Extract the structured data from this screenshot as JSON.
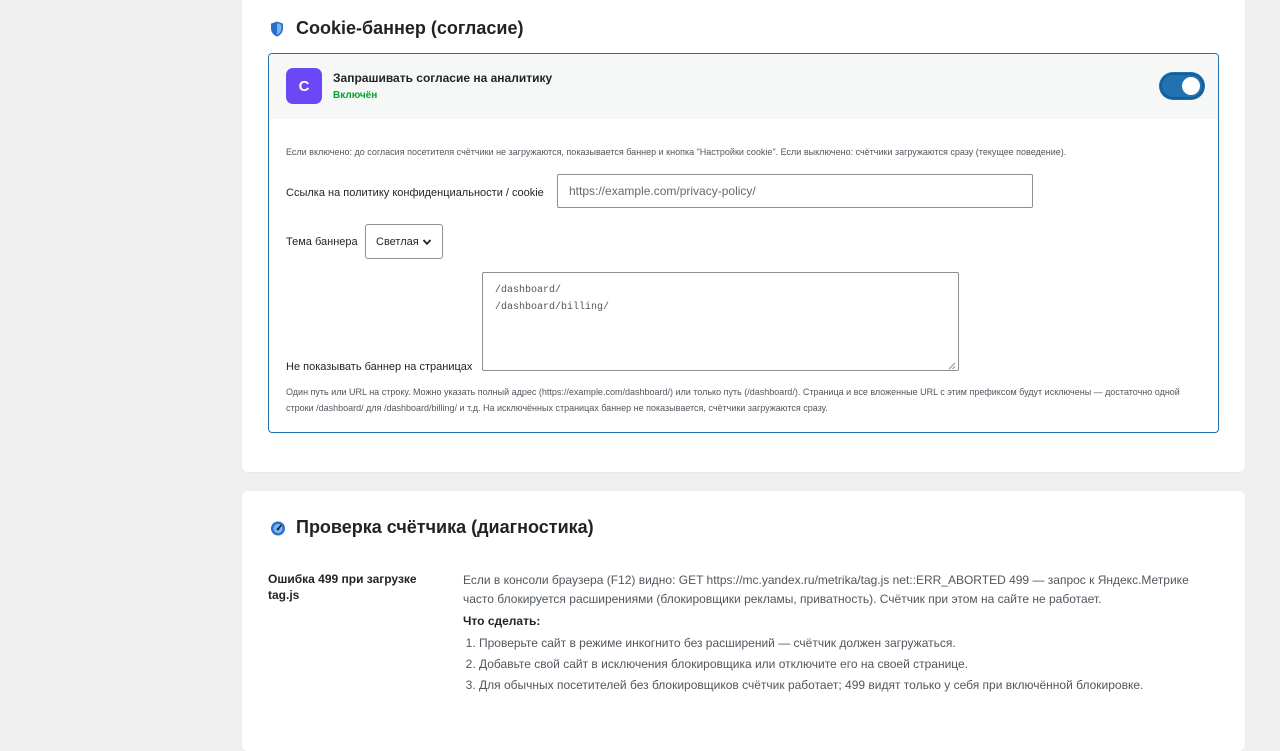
{
  "cookie_section": {
    "title": "Cookie-баннер (согласие)",
    "icon": "shield-icon",
    "feature": {
      "avatar_letter": "C",
      "avatar_color": "#6c47f5",
      "title": "Запрашивать согласие на аналитику",
      "status": "Включён",
      "status_color": "#00a32a",
      "enabled": true,
      "description": "Если включено: до согласия посетителя счётчики не загружаются, показывается баннер и кнопка \"Настройки cookie\". Если выключено: счётчики загружаются сразу (текущее поведение).",
      "privacy_label": "Ссылка на политику конфиденциальности / cookie",
      "privacy_placeholder": "https://example.com/privacy-policy/",
      "theme_label": "Тема баннера",
      "theme_value": "Светлая",
      "exclude_label": "Не показывать баннер на страницах",
      "exclude_lines": [
        "/dashboard/",
        "/dashboard/billing/"
      ],
      "exclude_hint": "Один путь или URL на строку. Можно указать полный адрес (https://example.com/dashboard/) или только путь (/dashboard/). Страница и все вложенные URL с этим префиксом будут исключены — достаточно одной строки /dashboard/ для /dashboard/billing/ и т.д. На исключённых страницах баннер не показывается, счётчики загружаются сразу."
    }
  },
  "diag_section": {
    "title": "Проверка счётчика (диагностика)",
    "icon": "gauge-icon",
    "error_title": "Ошибка 499 при загрузке tag.js",
    "error_text": "Если в консоли браузера (F12) видно: GET https://mc.yandex.ru/metrika/tag.js net::ERR_ABORTED 499 — запрос к Яндекс.Метрике часто блокируется расширениями (блокировщики рекламы, приватность). Счётчик при этом на сайте не работает.",
    "what_to_do": "Что сделать:",
    "steps": [
      "Проверьте сайт в режиме инкогнито без расширений — счётчик должен загружаться.",
      "Добавьте свой сайт в исключения блокировщика или отключите его на своей странице.",
      "Для обычных посетителей без блокировщиков счётчик работает; 499 видят только у себя при включённой блокировке."
    ]
  },
  "colors": {
    "accent": "#2271b1",
    "background": "#f0f0f1"
  }
}
